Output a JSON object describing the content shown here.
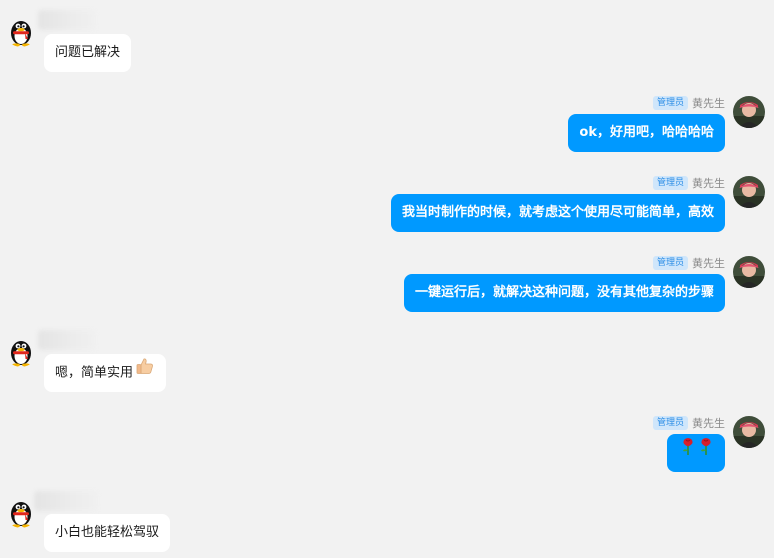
{
  "colors": {
    "background": "#f2f2f2",
    "incoming_bubble": "#ffffff",
    "outgoing_bubble": "#0099ff",
    "badge_bg": "#cfe6fb",
    "badge_text": "#2d8ee6"
  },
  "owner": {
    "role": "管理员",
    "name": "黄先生"
  },
  "messages": [
    {
      "direction": "incoming",
      "avatar": "qq-penguin-icon",
      "text": "问题已解决"
    },
    {
      "direction": "outgoing",
      "avatar": "user-photo-avatar",
      "text": "ok，好用吧，哈哈哈哈"
    },
    {
      "direction": "outgoing",
      "avatar": "user-photo-avatar",
      "text": "我当时制作的时候，就考虑这个使用尽可能简单，高效"
    },
    {
      "direction": "outgoing",
      "avatar": "user-photo-avatar",
      "text": "一键运行后，就解决这种问题，没有其他复杂的步骤"
    },
    {
      "direction": "incoming",
      "avatar": "qq-penguin-icon",
      "text": "嗯，简单实用",
      "emoji": "thumbs-up-icon"
    },
    {
      "direction": "outgoing",
      "avatar": "user-photo-avatar",
      "emoji": "rose-icon"
    },
    {
      "direction": "incoming",
      "avatar": "qq-penguin-icon",
      "text": "小白也能轻松驾驭"
    }
  ]
}
